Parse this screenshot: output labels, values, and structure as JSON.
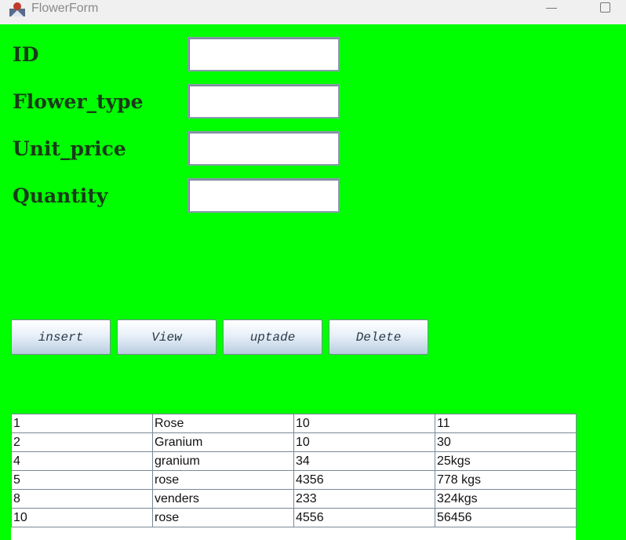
{
  "window": {
    "title": "FlowerForm",
    "app_icon": "java-app-icon",
    "minimize_icon": "minimize-icon",
    "maximize_icon": "maximize-icon"
  },
  "form": {
    "id_label": "ID",
    "flower_type_label": "Flower_type",
    "unit_price_label": "Unit_price",
    "quantity_label": "Quantity",
    "id_value": "",
    "flower_type_value": "",
    "unit_price_value": "",
    "quantity_value": ""
  },
  "buttons": {
    "insert": "insert",
    "view": "View",
    "update": "uptade",
    "delete": "Delete"
  },
  "table": {
    "rows": [
      [
        "1",
        "Rose",
        "10",
        "11"
      ],
      [
        "2",
        "Granium",
        "10",
        "30"
      ],
      [
        "4",
        "granium",
        "34",
        "25kgs"
      ],
      [
        "5",
        "rose",
        "4356",
        "778 kgs"
      ],
      [
        "8",
        "venders",
        "233",
        "324kgs"
      ],
      [
        "10",
        "rose",
        "4556",
        "56456"
      ]
    ]
  },
  "colors": {
    "background": "#00ff00",
    "label_text": "#1a3a1a"
  }
}
